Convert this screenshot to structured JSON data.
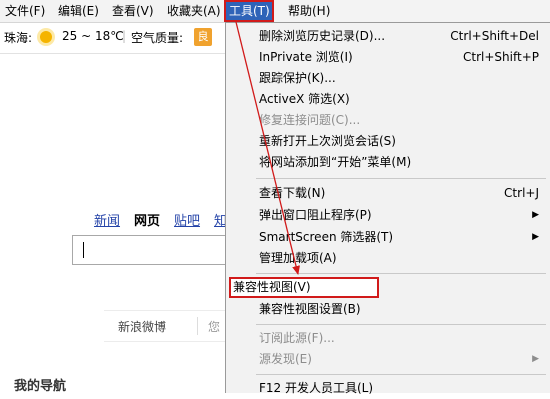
{
  "menubar": {
    "items": [
      {
        "label": "文件(F)"
      },
      {
        "label": "编辑(E)"
      },
      {
        "label": "查看(V)"
      },
      {
        "label": "收藏夹(A)"
      },
      {
        "label": "工具(T)",
        "active": true
      },
      {
        "label": "帮助(H)"
      }
    ]
  },
  "weather": {
    "city": "珠海:",
    "temp": "25 ~ 18℃",
    "aq_label": "空气质量:",
    "aq_value": "良"
  },
  "search": {
    "links": [
      {
        "label": "新闻"
      },
      {
        "label": "网页"
      },
      {
        "label": "贴吧"
      },
      {
        "label": "知"
      }
    ]
  },
  "weibo": {
    "label": "新浪微博",
    "partial": "您"
  },
  "my_nav": "我的导航",
  "tools_menu": {
    "items": [
      {
        "label": "删除浏览历史记录(D)...",
        "shortcut": "Ctrl+Shift+Del"
      },
      {
        "label": "InPrivate 浏览(I)",
        "shortcut": "Ctrl+Shift+P"
      },
      {
        "label": "跟踪保护(K)..."
      },
      {
        "label": "ActiveX 筛选(X)"
      },
      {
        "label": "修复连接问题(C)...",
        "disabled": true
      },
      {
        "label": "重新打开上次浏览会话(S)"
      },
      {
        "label": "将网站添加到“开始”菜单(M)"
      },
      {
        "label": "查看下载(N)",
        "shortcut": "Ctrl+J"
      },
      {
        "label": "弹出窗口阻止程序(P)",
        "submenu": true
      },
      {
        "label": "SmartScreen 筛选器(T)",
        "submenu": true
      },
      {
        "label": "管理加载项(A)"
      },
      {
        "label": "兼容性视图(V)",
        "highlighted": true
      },
      {
        "label": "兼容性视图设置(B)"
      },
      {
        "label": "订阅此源(F)...",
        "disabled": true
      },
      {
        "label": "源发现(E)",
        "disabled": true,
        "submenu": true
      },
      {
        "label": "F12 开发人员工具(L)"
      }
    ]
  },
  "annotation_color": "#d11a1a",
  "active_menu_color": "#2e63b8"
}
